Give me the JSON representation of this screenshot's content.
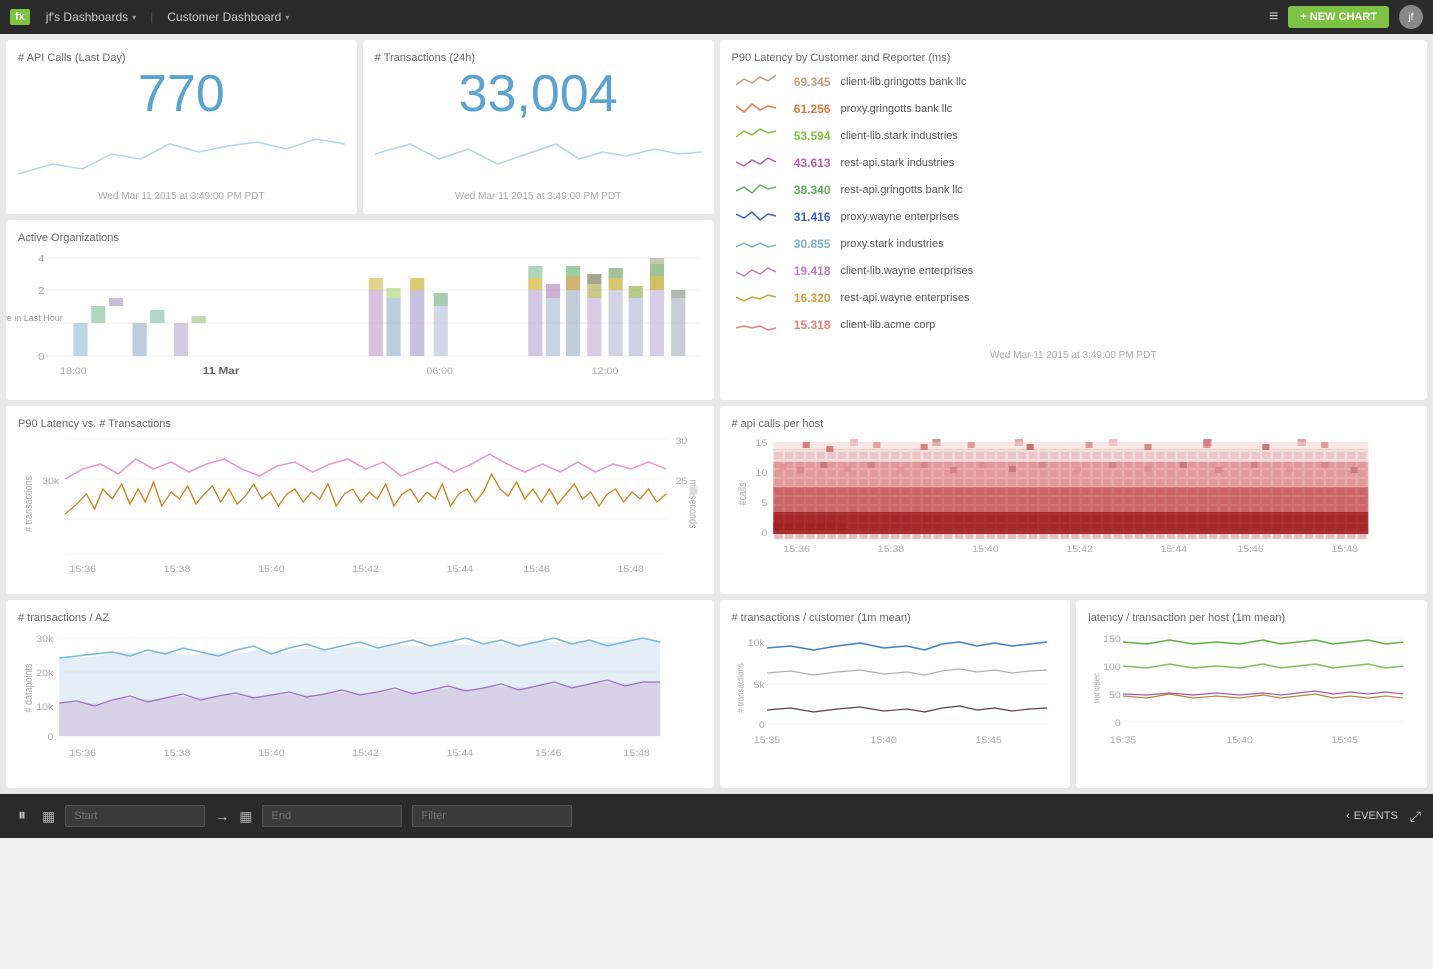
{
  "topnav": {
    "logo": "fx",
    "dashboards_label": "jf's Dashboards",
    "current_dashboard": "Customer Dashboard",
    "new_chart_label": "+ NEW CHART",
    "hamburger": "≡"
  },
  "cards": {
    "api_calls": {
      "title": "# API Calls (Last Day)",
      "value": "770",
      "timestamp": "Wed Mar 11 2015 at 3:49:00 PM PDT"
    },
    "transactions": {
      "title": "# Transactions (24h)",
      "value": "33,004",
      "timestamp": "Wed Mar 11 2015 at 3:49:00 PM PDT"
    },
    "p90_latency": {
      "title": "P90 Latency by Customer and Reporter (ms)",
      "timestamp": "Wed Mar 11 2015 at 3:49:00 PM PDT",
      "rows": [
        {
          "value": "69.345",
          "label": "client-lib.gringotts bank llc",
          "color": "#c0a080"
        },
        {
          "value": "61.256",
          "label": "proxy.gringotts bank llc",
          "color": "#e07840"
        },
        {
          "value": "53.594",
          "label": "client-lib.stark industries",
          "color": "#80c040"
        },
        {
          "value": "43.613",
          "label": "rest-api.stark industries",
          "color": "#b060b0"
        },
        {
          "value": "38.340",
          "label": "rest-api.gringotts bank llc",
          "color": "#60b060"
        },
        {
          "value": "31.416",
          "label": "proxy.wayne enterprises",
          "color": "#4060c0"
        },
        {
          "value": "30.855",
          "label": "proxy.stark industries",
          "color": "#80b0d0"
        },
        {
          "value": "19.418",
          "label": "client-lib.wayne enterprises",
          "color": "#c080c0"
        },
        {
          "value": "16.320",
          "label": "rest-api.wayne enterprises",
          "color": "#d0a040"
        },
        {
          "value": "15.318",
          "label": "client-lib.acme corp",
          "color": "#e08080"
        }
      ]
    },
    "active_orgs": {
      "title": "Active Organizations",
      "y_label": "Active in Last Hour",
      "x_labels": [
        "18:00",
        "11 Mar",
        "06:00",
        "12:00"
      ]
    },
    "p90_vs_transactions": {
      "title": "P90 Latency vs. # Transactions",
      "y_label_left": "# transactions",
      "y_label_right": "milliseconds",
      "x_labels": [
        "15:36",
        "15:38",
        "15:40",
        "15:42",
        "15:44",
        "15:46",
        "15:48"
      ],
      "y_left_values": [
        "30k"
      ],
      "y_right_values": [
        "30",
        "25"
      ]
    },
    "api_per_host": {
      "title": "# api calls per host",
      "y_label": "#calls",
      "y_values": [
        "15",
        "10",
        "5",
        "0"
      ],
      "x_labels": [
        "15:36",
        "15:38",
        "15:40",
        "15:42",
        "15:44",
        "15:46",
        "15:48"
      ]
    },
    "transactions_az": {
      "title": "# transactions / AZ",
      "y_label": "# datapoints",
      "y_values": [
        "30k",
        "20k",
        "10k",
        "0"
      ],
      "x_labels": [
        "15:36",
        "15:38",
        "15:40",
        "15:42",
        "15:44",
        "15:46",
        "15:48"
      ]
    },
    "transactions_customer": {
      "title": "# transactions / customer (1m mean)",
      "y_label": "# transactions",
      "y_values": [
        "10k",
        "5k",
        "0"
      ],
      "x_labels": [
        "15:35",
        "15:40",
        "15:45"
      ]
    },
    "latency_per_host": {
      "title": "latency / transaction per host (1m mean)",
      "y_label": "nanosec",
      "y_values": [
        "150",
        "100",
        "50",
        "0"
      ],
      "x_labels": [
        "15:35",
        "15:40",
        "15:45"
      ]
    }
  },
  "bottomnav": {
    "pause_icon": "⏸",
    "calendar_icon": "▦",
    "start_placeholder": "Start",
    "end_placeholder": "End",
    "filter_placeholder": "Filter",
    "events_label": "EVENTS",
    "expand_icon": "⤢"
  }
}
